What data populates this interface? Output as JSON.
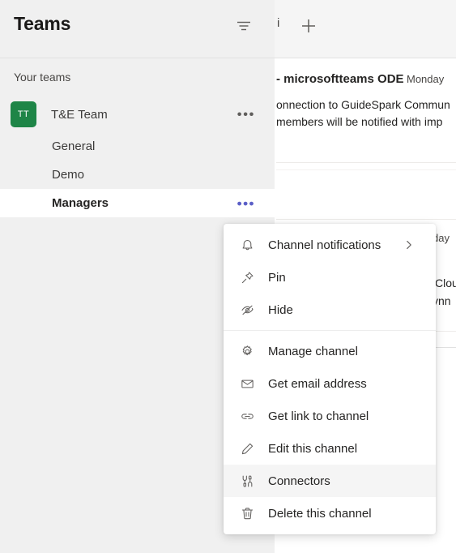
{
  "sidebar": {
    "title": "Teams",
    "filter_icon": "filter-icon",
    "section_label": "Your teams",
    "team": {
      "avatar_initials": "TT",
      "avatar_color": "#1e8547",
      "name": "T&E Team",
      "overflow_label": "•••"
    },
    "channels": [
      {
        "name": "General",
        "selected": false,
        "overflow_label": ""
      },
      {
        "name": "Demo",
        "selected": false,
        "overflow_label": ""
      },
      {
        "name": "Managers",
        "selected": true,
        "overflow_label": "•••"
      }
    ]
  },
  "main": {
    "tab_fragment": "i",
    "add_tab_label": "+",
    "messages": [
      {
        "sender": "- microsoftteams ODE",
        "time": "Monday",
        "body_line1": "onnection to GuideSpark Commun",
        "body_line2": "members will be notified with imp"
      },
      {
        "time_fragment": "day",
        "frag1": "Clou",
        "frag2": "ynn"
      }
    ]
  },
  "context_menu": {
    "groups": [
      {
        "items": [
          {
            "label": "Channel notifications",
            "icon": "bell-icon",
            "has_submenu": true,
            "highlighted": false
          },
          {
            "label": "Pin",
            "icon": "pin-icon",
            "has_submenu": false,
            "highlighted": false
          },
          {
            "label": "Hide",
            "icon": "eye-off-icon",
            "has_submenu": false,
            "highlighted": false
          }
        ]
      },
      {
        "items": [
          {
            "label": "Manage channel",
            "icon": "gear-icon",
            "has_submenu": false,
            "highlighted": false
          },
          {
            "label": "Get email address",
            "icon": "envelope-icon",
            "has_submenu": false,
            "highlighted": false
          },
          {
            "label": "Get link to channel",
            "icon": "link-icon",
            "has_submenu": false,
            "highlighted": false
          },
          {
            "label": "Edit this channel",
            "icon": "pencil-icon",
            "has_submenu": false,
            "highlighted": false
          },
          {
            "label": "Connectors",
            "icon": "connectors-icon",
            "has_submenu": false,
            "highlighted": true
          },
          {
            "label": "Delete this channel",
            "icon": "trash-icon",
            "has_submenu": false,
            "highlighted": false
          }
        ]
      }
    ]
  },
  "colors": {
    "sidebar_bg": "#f0f0f0",
    "selected_row_bg": "#ffffff",
    "accent_purple": "#5b5fc7",
    "team_avatar_green": "#1e8547",
    "menu_highlight": "#f5f5f5"
  }
}
